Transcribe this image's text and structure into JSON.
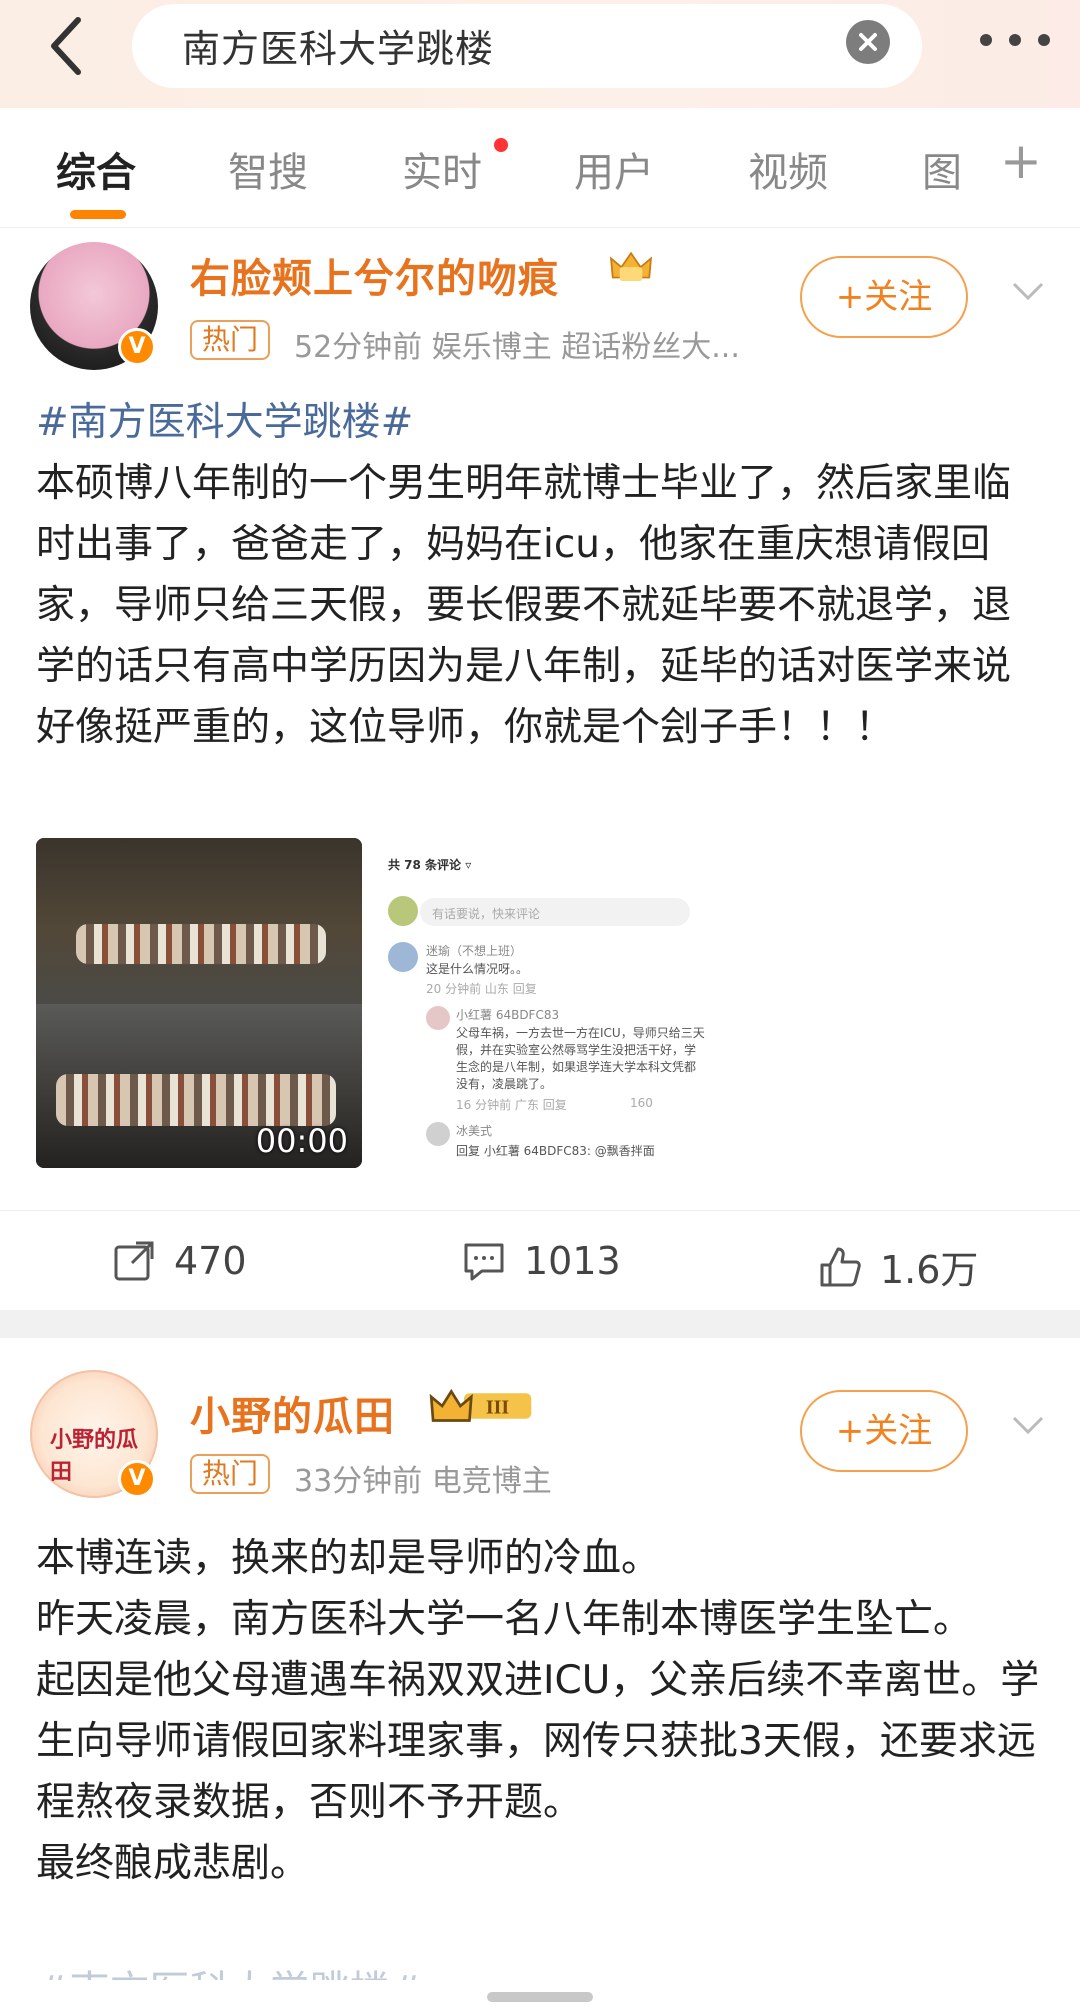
{
  "search": {
    "query": "南方医科大学跳楼",
    "more_label": "•••"
  },
  "tabs": [
    {
      "label": "综合"
    },
    {
      "label": "智搜"
    },
    {
      "label": "实时"
    },
    {
      "label": "用户"
    },
    {
      "label": "视频"
    },
    {
      "label": "图"
    }
  ],
  "tab_plus": "+",
  "posts": [
    {
      "username": "右脸颊上兮尔的吻痕",
      "tag": "热门",
      "meta": "52分钟前   娱乐博主 超话粉丝大...",
      "follow": "+关注",
      "hashtag": "#南方医科大学跳楼#",
      "text": "本硕博八年制的一个男生明年就博士毕业了，然后家里临时出事了，爸爸走了，妈妈在icu，他家在重庆想请假回家，导师只给三天假，要长假要不就延毕要不就退学，退学的话只有高中学历因为是八年制，延毕的话对医学来说好像挺严重的，这位导师，你就是个刽子手！！！",
      "video_time": "00:00",
      "screenshot": {
        "header": "共 78 条评论 ▿",
        "input_placeholder": "有话要说，快来评论",
        "c1_name": "迷瑜（不想上班）",
        "c1_text": "这是什么情况呀。。",
        "c1_meta": "20 分钟前  山东   回复",
        "c2_name": "小红薯 64BDFC83",
        "c2_line1": "父母车祸，一方去世一方在ICU，导师只给三天",
        "c2_line2": "假，并在实验室公然辱骂学生没把活干好，学",
        "c2_line3": "生念的是八年制，如果退学连大学本科文凭都",
        "c2_line4": "没有，凌晨跳了。",
        "c2_meta": "16 分钟前  广东   回复",
        "c2_likes": "160",
        "c3_name": "冰美式",
        "c3_text": "回复 小红薯 64BDFC83: @飘香拌面"
      },
      "actions": {
        "repost": "470",
        "comment": "1013",
        "like": "1.6万"
      }
    },
    {
      "username": "小野的瓜田",
      "avatar_text": "小野的瓜田",
      "tag": "热门",
      "meta": "33分钟前   电竞博主",
      "follow": "+关注",
      "lines": [
        "本博连读，换来的却是导师的冷血。",
        "昨天凌晨，南方医科大学一名八年制本博医学生坠亡。",
        "起因是他父母遭遇车祸双双进ICU，父亲后续不幸离世。学生向导师请假回家料理家事，网传只获批3天假，还要求远程熬夜录数据，否则不予开题。",
        "最终酿成悲剧。"
      ],
      "cut_hashtag": "#南方医科大学跳楼#"
    }
  ]
}
